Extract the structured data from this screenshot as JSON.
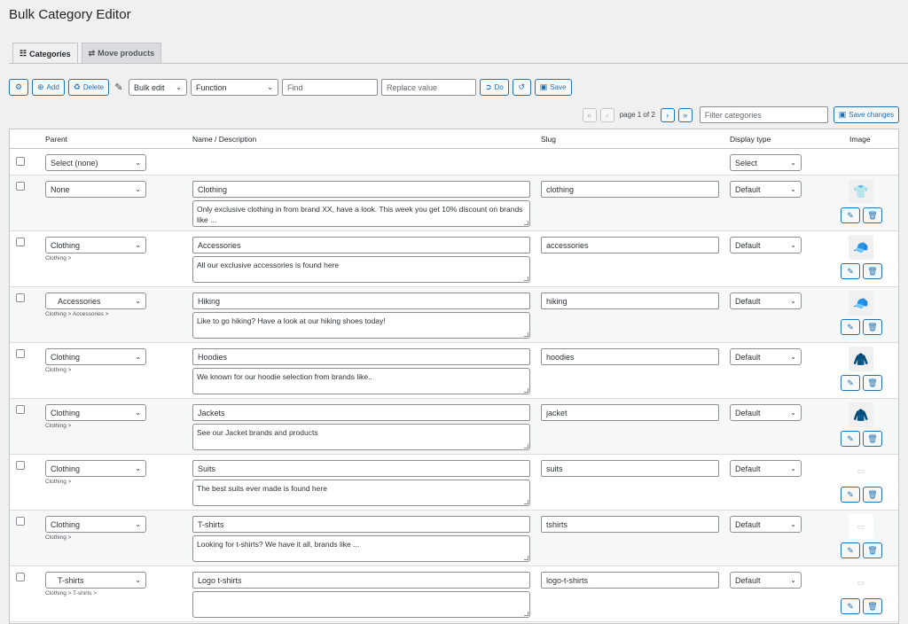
{
  "page_title": "Bulk Category Editor",
  "tabs": [
    {
      "label": "Categories",
      "icon": "list-icon",
      "active": true
    },
    {
      "label": "Move products",
      "icon": "swap-icon",
      "active": false
    }
  ],
  "toolbar": {
    "add_label": "Add",
    "delete_label": "Delete",
    "bulk_edit_value": "Bulk edit",
    "function_value": "Function",
    "find_placeholder": "Find",
    "replace_placeholder": "Replace value",
    "do_label": "Do",
    "save_label": "Save"
  },
  "pager": {
    "page_text": "page 1 of 2",
    "filter_placeholder": "Filter categories",
    "save_changes_label": "Save changes"
  },
  "columns": {
    "parent": "Parent",
    "name": "Name / Description",
    "slug": "Slug",
    "display_type": "Display type",
    "image": "Image"
  },
  "filter_row": {
    "parent_value": "Select (none)",
    "display_value": "Select"
  },
  "rows": [
    {
      "parent": "None",
      "crumb": "",
      "name": "Clothing",
      "description": "Only exclusive clothing in from brand XX, have a look. This week you get 10% discount on brands like ...",
      "slug": "clothing",
      "display": "Default",
      "image": "shirts-icon"
    },
    {
      "parent": "Clothing",
      "crumb": "Clothing >",
      "name": "Accessories",
      "description": "All our exclusive accessories is found here",
      "slug": "accessories",
      "display": "Default",
      "image": "cap-icon"
    },
    {
      "parent": "Accessories",
      "crumb": "Clothing > Accessories >",
      "name": "Hiking",
      "description": "Like to go hiking? Have a look at our hiking shoes today!",
      "slug": "hiking",
      "display": "Default",
      "image": "cap-icon"
    },
    {
      "parent": "Clothing",
      "crumb": "Clothing >",
      "name": "Hoodies",
      "description": "We known for our hoodie selection from brands like..",
      "slug": "hoodies",
      "display": "Default",
      "image": "hoodie-icon"
    },
    {
      "parent": "Clothing",
      "crumb": "Clothing >",
      "name": "Jackets",
      "description": "See our Jacket brands and products",
      "slug": "jacket",
      "display": "Default",
      "image": "hoodie-icon"
    },
    {
      "parent": "Clothing",
      "crumb": "Clothing >",
      "name": "Suits",
      "description": "The best suits ever made is found here",
      "slug": "suits",
      "display": "Default",
      "image": "placeholder-image-icon"
    },
    {
      "parent": "Clothing",
      "crumb": "Clothing >",
      "name": "T-shirts",
      "description": "Looking for t-shirts? We have it all, brands like ...",
      "slug": "tshirts",
      "display": "Default",
      "image": "placeholder-image-icon"
    },
    {
      "parent": "T-shirts",
      "crumb": "Clothing > T-shirts >",
      "name": "Logo t-shirts",
      "description": "",
      "slug": "logo-t-shirts",
      "display": "Default",
      "image": "placeholder-image-icon"
    }
  ]
}
